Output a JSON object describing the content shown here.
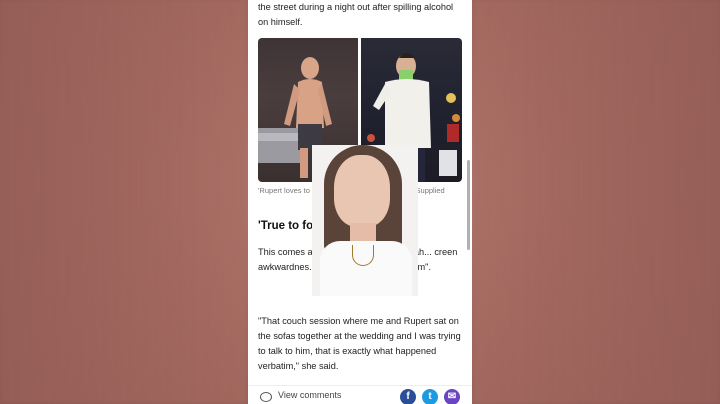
{
  "article": {
    "para_top": "the street during a night out after spilling alcohol on himself.",
    "caption": "'Rupert loves to part... been confident.' Photos: Supplied",
    "heading": "'True to form'",
    "para_mid": "This comes a... wife Evelyn Ellis told Yah... creen awkwardnes... wedding was \"true to form\".",
    "para_quote": "\"That couch session where me and Rupert sat on the sofas together at the wedding and I was trying to talk to him, that is exactly what happened verbatim,\" she said."
  },
  "footer": {
    "comments_label": "View comments",
    "facebook_glyph": "f",
    "twitter_glyph": "t",
    "email_glyph": "✉"
  },
  "icons": [
    "chat-bubble-icon",
    "facebook-icon",
    "twitter-icon",
    "email-icon"
  ],
  "colors": {
    "facebook": "#2a4f98",
    "twitter": "#1e9ae0",
    "email": "#6a45c2",
    "background": "#a0685f"
  }
}
